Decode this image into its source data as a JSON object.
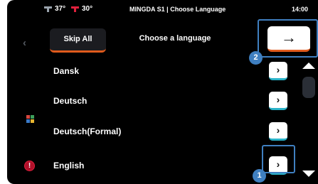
{
  "status_bar": {
    "nozzle_temp": "37°",
    "bed_temp": "30°",
    "title": "MINGDA S1 | Choose Language",
    "time": "14:00"
  },
  "header": {
    "skip_label": "Skip All",
    "title": "Choose a language",
    "next_icon": "→"
  },
  "languages": [
    {
      "label": "Dansk",
      "arrow": "›"
    },
    {
      "label": "Deutsch",
      "arrow": "›"
    },
    {
      "label": "Deutsch(Formal)",
      "arrow": "›"
    },
    {
      "label": "English",
      "arrow": "›"
    }
  ],
  "badges": {
    "first": "1",
    "second": "2"
  },
  "left_rail": {
    "back_icon": "‹",
    "warning_icon": "!"
  },
  "colors": {
    "accent_orange": "#e05a1c",
    "accent_cyan": "#2ab3c9",
    "highlight_blue": "#3f7fc0",
    "warning_red": "#b0102a"
  }
}
